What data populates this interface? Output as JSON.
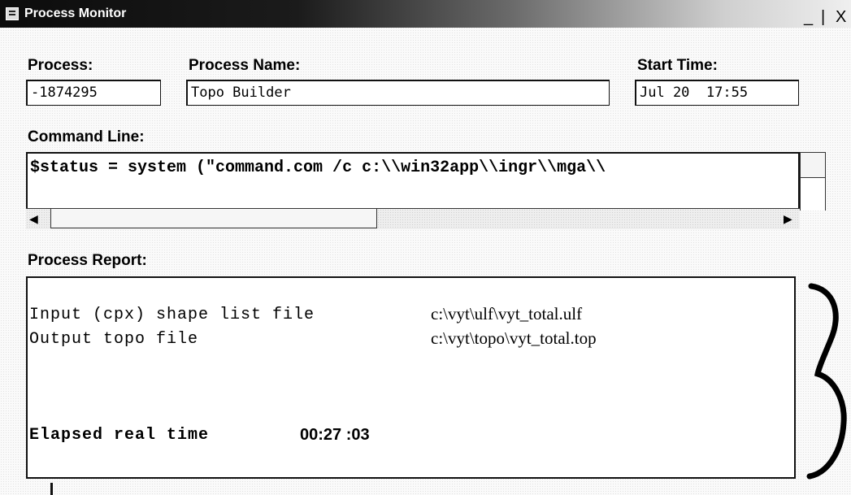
{
  "window": {
    "title": "Process Monitor",
    "minimize": "_",
    "maximize": "|",
    "close": "X"
  },
  "fields": {
    "process_label": "Process:",
    "process_value": "-1874295",
    "name_label": "Process Name:",
    "name_value": "Topo Builder",
    "start_label": "Start Time:",
    "start_value": "Jul 20  17:55"
  },
  "command": {
    "label": "Command Line:",
    "text": "$status = system (\"command.com /c c:\\\\win32app\\\\ingr\\\\mga\\\\"
  },
  "report": {
    "label": "Process Report:",
    "lines": [
      {
        "label": "Input (cpx) shape list file",
        "value": "c:\\vyt\\ulf\\vyt_total.ulf"
      },
      {
        "label": "Output topo file",
        "value": "c:\\vyt\\topo\\vyt_total.top"
      }
    ],
    "elapsed_label": "Elapsed real time",
    "elapsed_value": "00:27 :03"
  },
  "icons": [
    "window-menu-icon",
    "scroll-left-arrow-icon",
    "scroll-right-arrow-icon",
    "page-number-3-glyph"
  ]
}
